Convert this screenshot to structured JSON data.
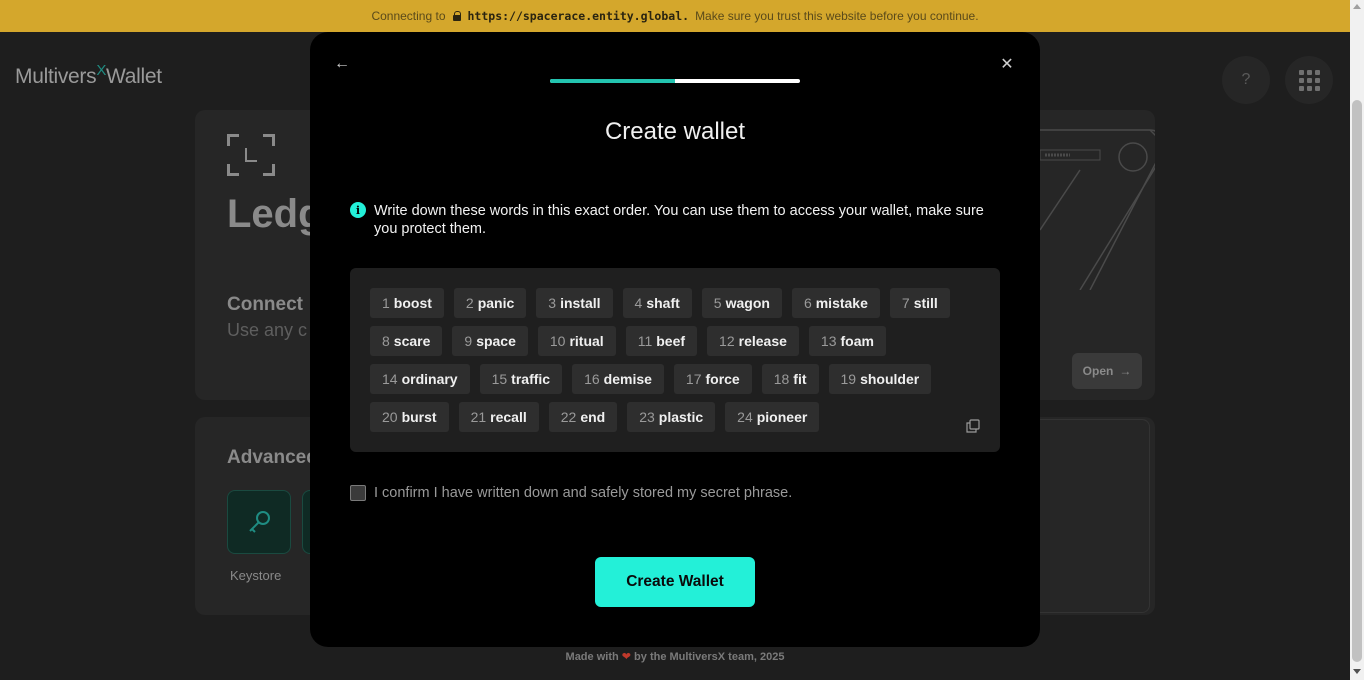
{
  "banner": {
    "prefix": "Connecting to",
    "url": "https://spacerace.entity.global.",
    "suffix": "Make sure you trust this website before you continue."
  },
  "app": {
    "logo_main": "Multivers",
    "logo_x": "X",
    "logo_suffix": "Wallet",
    "help_glyph": "?"
  },
  "background": {
    "ledger_title": "Ledg",
    "connect_title": "Connect",
    "connect_sub": "Use any c",
    "open_label": "Open",
    "advanced_title": "Advanced",
    "keystore_label": "Keystore"
  },
  "modal": {
    "title": "Create wallet",
    "progress": 0.5,
    "info_text": "Write down these words in this exact order. You can use them to access your wallet, make sure you protect them.",
    "words": [
      {
        "n": "1",
        "w": "boost"
      },
      {
        "n": "2",
        "w": "panic"
      },
      {
        "n": "3",
        "w": "install"
      },
      {
        "n": "4",
        "w": "shaft"
      },
      {
        "n": "5",
        "w": "wagon"
      },
      {
        "n": "6",
        "w": "mistake"
      },
      {
        "n": "7",
        "w": "still"
      },
      {
        "n": "8",
        "w": "scare"
      },
      {
        "n": "9",
        "w": "space"
      },
      {
        "n": "10",
        "w": "ritual"
      },
      {
        "n": "11",
        "w": "beef"
      },
      {
        "n": "12",
        "w": "release"
      },
      {
        "n": "13",
        "w": "foam"
      },
      {
        "n": "14",
        "w": "ordinary"
      },
      {
        "n": "15",
        "w": "traffic"
      },
      {
        "n": "16",
        "w": "demise"
      },
      {
        "n": "17",
        "w": "force"
      },
      {
        "n": "18",
        "w": "fit"
      },
      {
        "n": "19",
        "w": "shoulder"
      },
      {
        "n": "20",
        "w": "burst"
      },
      {
        "n": "21",
        "w": "recall"
      },
      {
        "n": "22",
        "w": "end"
      },
      {
        "n": "23",
        "w": "plastic"
      },
      {
        "n": "24",
        "w": "pioneer"
      }
    ],
    "confirm_label": "I confirm I have written down and safely stored my secret phrase.",
    "confirm_checked": false,
    "create_button": "Create Wallet"
  },
  "footer": {
    "before": "Made with",
    "after": "by the MultiversX team, 2025"
  },
  "colors": {
    "accent": "#23f0d8",
    "banner": "#d4a72c",
    "heart": "#c0392b"
  }
}
